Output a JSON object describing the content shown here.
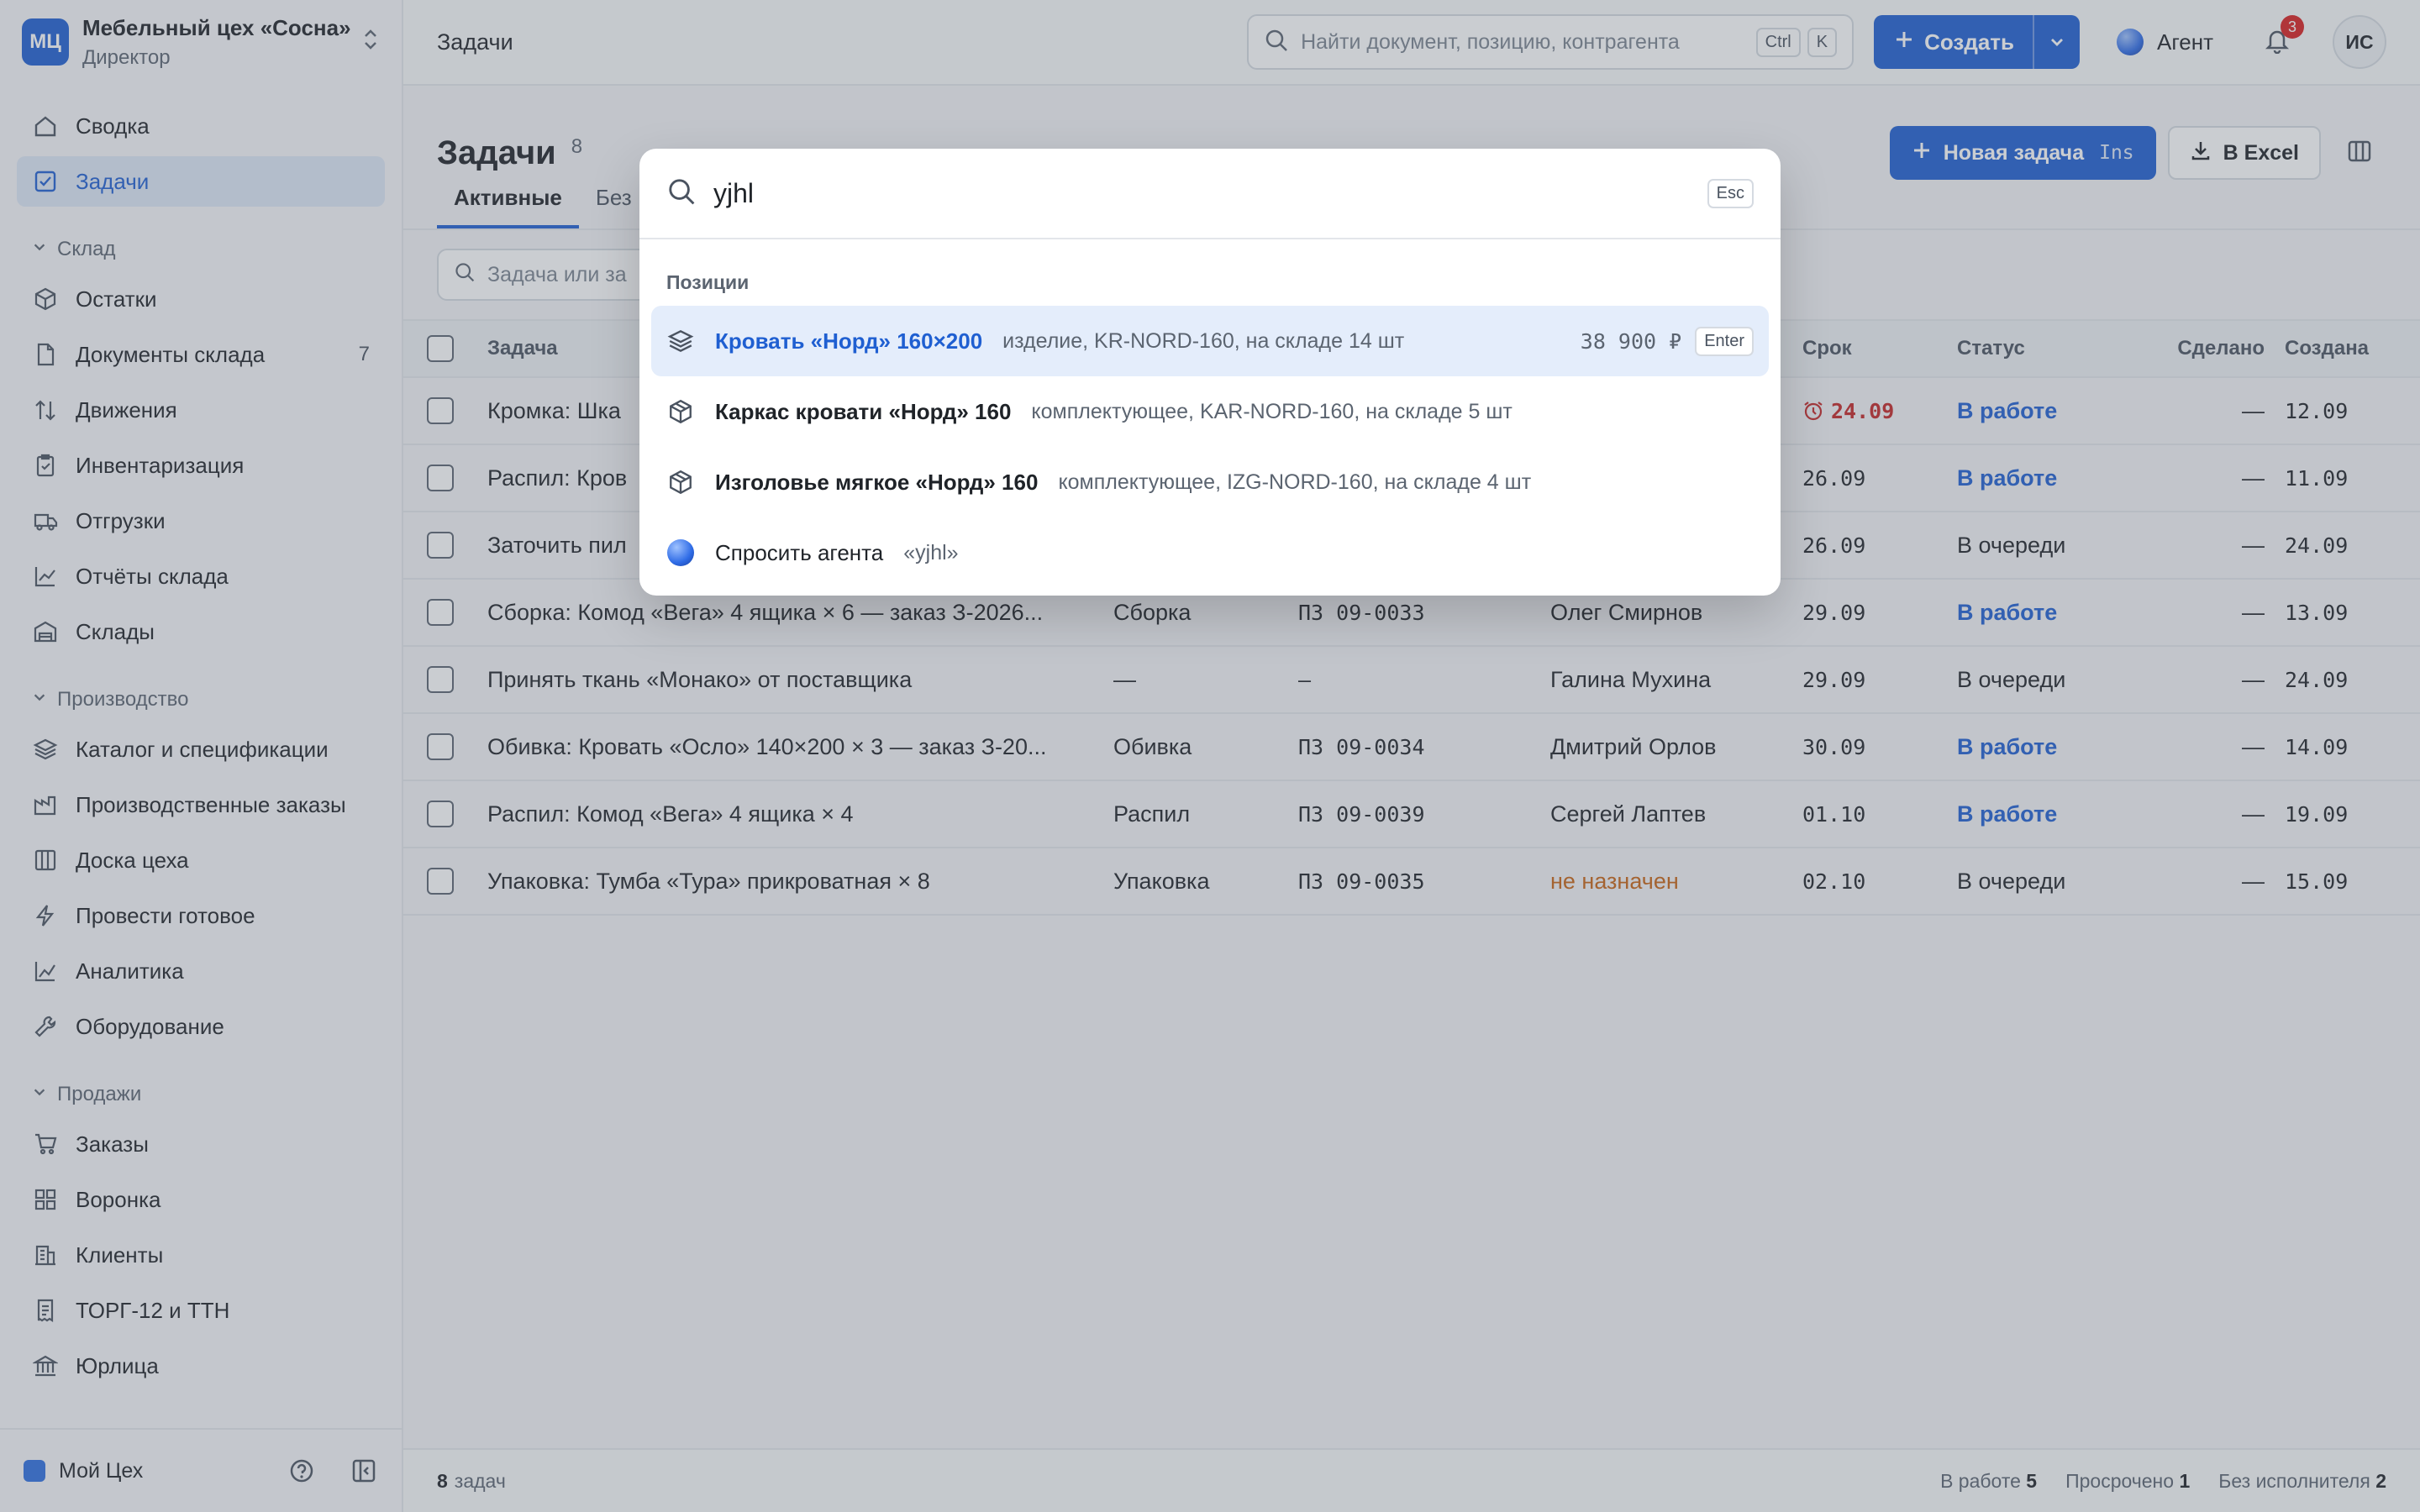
{
  "workspace": {
    "logo": "МЦ",
    "name": "Мебельный цех «Сосна»",
    "role": "Директор"
  },
  "sidebar": {
    "top": [
      {
        "label": "Сводка",
        "icon": "home-icon"
      },
      {
        "label": "Задачи",
        "icon": "checkbox-icon",
        "active": true
      }
    ],
    "sections": [
      {
        "title": "Склад",
        "items": [
          {
            "label": "Остатки",
            "icon": "box-icon"
          },
          {
            "label": "Документы склада",
            "icon": "document-icon",
            "count": "7"
          },
          {
            "label": "Движения",
            "icon": "arrows-icon"
          },
          {
            "label": "Инвентаризация",
            "icon": "clipboard-icon"
          },
          {
            "label": "Отгрузки",
            "icon": "truck-icon"
          },
          {
            "label": "Отчёты склада",
            "icon": "chart-line-icon"
          },
          {
            "label": "Склады",
            "icon": "warehouse-icon"
          }
        ]
      },
      {
        "title": "Производство",
        "items": [
          {
            "label": "Каталог и спецификации",
            "icon": "layers-icon"
          },
          {
            "label": "Производственные заказы",
            "icon": "factory-icon"
          },
          {
            "label": "Доска цеха",
            "icon": "board-icon"
          },
          {
            "label": "Провести готовое",
            "icon": "bolt-icon"
          },
          {
            "label": "Аналитика",
            "icon": "analytics-icon"
          },
          {
            "label": "Оборудование",
            "icon": "wrench-icon"
          }
        ]
      },
      {
        "title": "Продажи",
        "items": [
          {
            "label": "Заказы",
            "icon": "cart-icon"
          },
          {
            "label": "Воронка",
            "icon": "grid-icon"
          },
          {
            "label": "Клиенты",
            "icon": "building-icon"
          },
          {
            "label": "ТОРГ-12 и ТТН",
            "icon": "receipt-icon"
          },
          {
            "label": "Юрлица",
            "icon": "bank-icon"
          }
        ]
      }
    ],
    "footer": {
      "label": "Мой Цех"
    }
  },
  "topbar": {
    "crumb": "Задачи",
    "search_placeholder": "Найти документ, позицию, контрагента",
    "kbd1": "Ctrl",
    "kbd2": "K",
    "create_label": "Создать",
    "agent_label": "Агент",
    "notifications": "3",
    "avatar": "ИС"
  },
  "page": {
    "title": "Задачи",
    "count": "8",
    "new_task": "Новая задача",
    "new_task_kbd": "Ins",
    "excel": "В Excel",
    "tabs": [
      "Активные",
      "Без"
    ],
    "filter_placeholder": "Задача или за"
  },
  "table": {
    "headers": {
      "task": "Задача",
      "due": "Срок",
      "status": "Статус",
      "done": "Сделано",
      "created": "Создана"
    },
    "rows": [
      {
        "task": "Кромка: Шка",
        "stage": "",
        "order": "",
        "assignee": "",
        "due": "24.09",
        "due_overdue": true,
        "status": "В работе",
        "status_active": true,
        "done": "—",
        "created": "12.09"
      },
      {
        "task": "Распил: Кров",
        "stage": "",
        "order": "",
        "assignee": "",
        "due": "26.09",
        "status": "В работе",
        "status_active": true,
        "done": "—",
        "created": "11.09"
      },
      {
        "task": "Заточить пил",
        "stage": "",
        "order": "",
        "assignee": "",
        "due": "26.09",
        "status": "В очереди",
        "done": "—",
        "created": "24.09"
      },
      {
        "task": "Сборка: Комод «Вега» 4 ящика × 6 — заказ З-2026...",
        "stage": "Сборка",
        "order": "ПЗ 09-0033",
        "assignee": "Олег Смирнов",
        "due": "29.09",
        "status": "В работе",
        "status_active": true,
        "done": "—",
        "created": "13.09"
      },
      {
        "task": "Принять ткань «Монако» от поставщика",
        "stage": "—",
        "order": "—",
        "assignee": "Галина Мухина",
        "due": "29.09",
        "status": "В очереди",
        "done": "—",
        "created": "24.09"
      },
      {
        "task": "Обивка: Кровать «Осло» 140×200 × 3 — заказ З-20...",
        "stage": "Обивка",
        "order": "ПЗ 09-0034",
        "assignee": "Дмитрий Орлов",
        "due": "30.09",
        "status": "В работе",
        "status_active": true,
        "done": "—",
        "created": "14.09"
      },
      {
        "task": "Распил: Комод «Вега» 4 ящика × 4",
        "stage": "Распил",
        "order": "ПЗ 09-0039",
        "assignee": "Сергей Лаптев",
        "due": "01.10",
        "status": "В работе",
        "status_active": true,
        "done": "—",
        "created": "19.09"
      },
      {
        "task": "Упаковка: Тумба «Тура» прикроватная × 8",
        "stage": "Упаковка",
        "order": "ПЗ 09-0035",
        "assignee": "не назначен",
        "assignee_unassigned": true,
        "due": "02.10",
        "status": "В очереди",
        "done": "—",
        "created": "15.09"
      }
    ]
  },
  "footer": {
    "count": "8",
    "count_label": "задач",
    "in_work_label": "В работе",
    "in_work": "5",
    "overdue_label": "Просрочено",
    "overdue": "1",
    "unassigned_label": "Без исполнителя",
    "unassigned": "2"
  },
  "palette": {
    "query": "yjhl",
    "esc": "Esc",
    "section": "Позиции",
    "results": [
      {
        "icon": "layers-icon",
        "title": "Кровать «Норд» 160×200",
        "meta": "изделие, KR-NORD-160, на складе 14 шт",
        "price": "38 900 ₽",
        "hint": "Enter",
        "selected": true
      },
      {
        "icon": "package-icon",
        "title": "Каркас кровати «Норд» 160",
        "meta": "комплектующее, KAR-NORD-160, на складе 5 шт"
      },
      {
        "icon": "package-icon",
        "title": "Изголовье мягкое «Норд» 160",
        "meta": "комплектующее, IZG-NORD-160, на складе 4 шт"
      }
    ],
    "ask_agent": "Спросить агента",
    "ask_query": "«yjhl»"
  },
  "colors": {
    "accent": "#1f5fd1",
    "danger": "#c42626",
    "warning": "#c86414"
  }
}
